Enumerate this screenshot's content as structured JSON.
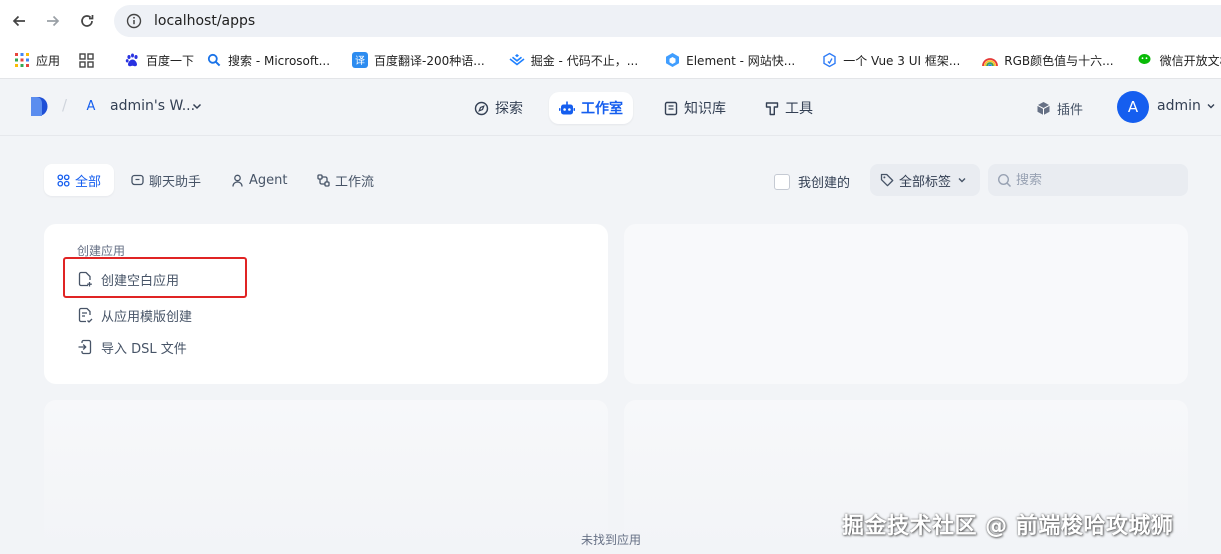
{
  "browser": {
    "url": "localhost/apps",
    "bookmarks": [
      {
        "label": "应用",
        "icon": "apps-grid-icon"
      },
      {
        "label": "",
        "icon": "tab-groups-icon"
      },
      {
        "label": "百度一下",
        "icon": "baidu-paw-icon"
      },
      {
        "label": "搜索 - Microsoft...",
        "icon": "search-icon"
      },
      {
        "label": "百度翻译-200种语...",
        "icon": "translate-icon"
      },
      {
        "label": "掘金 - 代码不止，...",
        "icon": "juejin-icon"
      },
      {
        "label": "Element - 网站快...",
        "icon": "element-icon"
      },
      {
        "label": "一个 Vue 3 UI 框架...",
        "icon": "vue-ui-icon"
      },
      {
        "label": "RGB颜色值与十六...",
        "icon": "rainbow-icon"
      },
      {
        "label": "微信开放文档",
        "icon": "wechat-icon"
      }
    ]
  },
  "header": {
    "workspace_initial": "A",
    "workspace_name": "admin's W...",
    "nav": {
      "explore": "探索",
      "studio": "工作室",
      "knowledge": "知识库",
      "tools": "工具"
    },
    "plugins": "插件",
    "user_initial": "A",
    "user_name": "admin"
  },
  "filters": {
    "tabs": {
      "all": "全部",
      "chat": "聊天助手",
      "agent": "Agent",
      "workflow": "工作流"
    },
    "my_created": "我创建的",
    "all_tags": "全部标签",
    "search_placeholder": "搜索"
  },
  "create_card": {
    "title": "创建应用",
    "blank": "创建空白应用",
    "template": "从应用模版创建",
    "import_dsl": "导入 DSL 文件"
  },
  "empty_text": "未找到应用",
  "watermark": "掘金技术社区 @ 前端梭哈攻城狮",
  "colors": {
    "accent": "#155eef",
    "highlight": "#e02424",
    "background": "#f2f4f7"
  }
}
